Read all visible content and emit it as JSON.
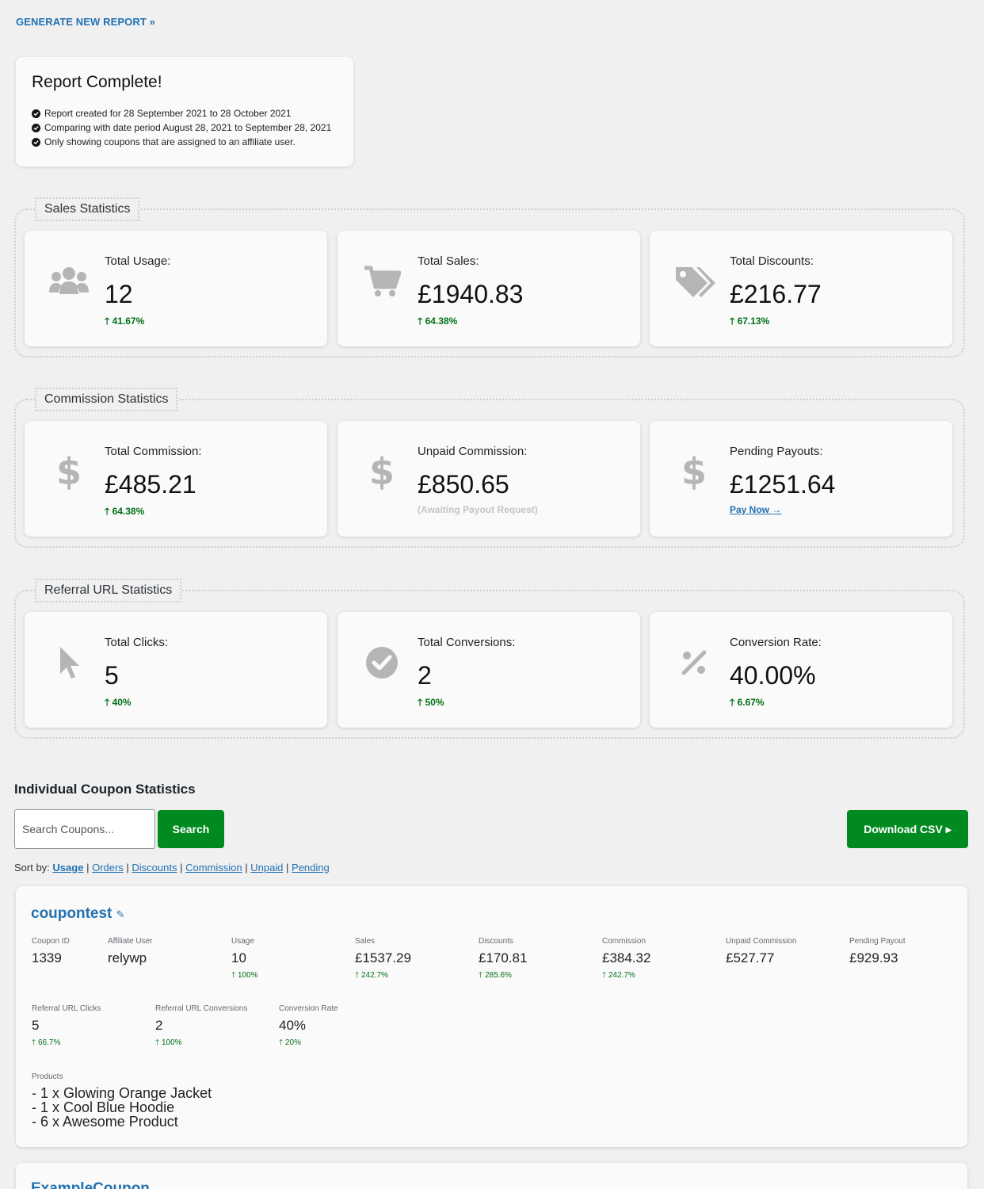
{
  "header": {
    "generate_link": "GENERATE NEW REPORT »"
  },
  "report": {
    "title": "Report Complete!",
    "lines": [
      "Report created for 28 September 2021 to 28 October 2021",
      "Comparing with date period August 28, 2021 to September 28, 2021",
      "Only showing coupons that are assigned to an affiliate user."
    ]
  },
  "sales": {
    "legend": "Sales Statistics",
    "cards": [
      {
        "label": "Total Usage:",
        "value": "12",
        "change": "41.67%",
        "icon": "users-icon"
      },
      {
        "label": "Total Sales:",
        "value": "£1940.83",
        "change": "64.38%",
        "icon": "cart-icon"
      },
      {
        "label": "Total Discounts:",
        "value": "£216.77",
        "change": "67.13%",
        "icon": "tags-icon"
      }
    ]
  },
  "commission": {
    "legend": "Commission Statistics",
    "cards": [
      {
        "label": "Total Commission:",
        "value": "£485.21",
        "change": "64.38%",
        "icon": "dollar-icon"
      },
      {
        "label": "Unpaid Commission:",
        "value": "£850.65",
        "note": "(Awaiting Payout Request)",
        "icon": "dollar-icon"
      },
      {
        "label": "Pending Payouts:",
        "value": "£1251.64",
        "link": "Pay Now",
        "icon": "dollar-icon"
      }
    ]
  },
  "referral": {
    "legend": "Referral URL Statistics",
    "cards": [
      {
        "label": "Total Clicks:",
        "value": "5",
        "change": "40%",
        "icon": "cursor-icon"
      },
      {
        "label": "Total Conversions:",
        "value": "2",
        "change": "50%",
        "icon": "check-circle-icon"
      },
      {
        "label": "Conversion Rate:",
        "value": "40.00%",
        "change": "6.67%",
        "icon": "percent-icon"
      }
    ]
  },
  "coupons": {
    "title": "Individual Coupon Statistics",
    "search_placeholder": "Search Coupons...",
    "search_button": "Search",
    "download_button": "Download CSV ▸",
    "sort_label": "Sort by:",
    "sort_options": [
      "Usage",
      "Orders",
      "Discounts",
      "Commission",
      "Unpaid",
      "Pending"
    ],
    "items": [
      {
        "name": "coupontest",
        "stats": [
          {
            "label": "Coupon ID",
            "value": "1339",
            "change": ""
          },
          {
            "label": "Affiliate User",
            "value": "relywp",
            "change": ""
          },
          {
            "label": "Usage",
            "value": "10",
            "change": "100%"
          },
          {
            "label": "Sales",
            "value": "£1537.29",
            "change": "242.7%"
          },
          {
            "label": "Discounts",
            "value": "£170.81",
            "change": "285.6%"
          },
          {
            "label": "Commission",
            "value": "£384.32",
            "change": "242.7%"
          },
          {
            "label": "Unpaid Commission",
            "value": "£527.77",
            "change": ""
          },
          {
            "label": "Pending Payout",
            "value": "£929.93",
            "change": ""
          },
          {
            "label": "Referral URL Clicks",
            "value": "5",
            "change": "66.7%"
          },
          {
            "label": "Referral URL Conversions",
            "value": "2",
            "change": "100%"
          },
          {
            "label": "Conversion Rate",
            "value": "40%",
            "change": "20%"
          }
        ],
        "products_label": "Products",
        "products": [
          "- 1 x Glowing Orange Jacket",
          "- 1 x Cool Blue Hoodie",
          "- 6 x Awesome Product"
        ]
      },
      {
        "name": "ExampleCoupon"
      }
    ]
  },
  "colors": {
    "accent": "#2271b1",
    "positive": "#007017",
    "button": "#008a20",
    "icon": "#b5b5b5"
  }
}
